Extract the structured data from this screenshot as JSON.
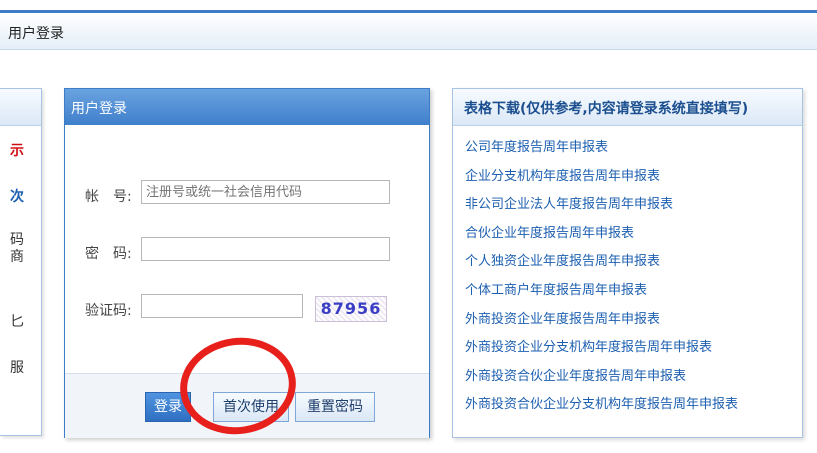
{
  "page": {
    "title": "用户登录"
  },
  "left_panel": {
    "fragments": [
      "示",
      "次",
      "码",
      "商",
      "匕",
      "服"
    ]
  },
  "login": {
    "header": "用户登录",
    "account_label": "帐　号:",
    "account_placeholder": "注册号或统一社会信用代码",
    "password_label": "密　码:",
    "captcha_label": "验证码:",
    "captcha_text": "87956",
    "buttons": {
      "login": "登录",
      "first_use": "首次使用",
      "reset": "重置密码"
    }
  },
  "downloads": {
    "header": "表格下载(仅供参考,内容请登录系统直接填写)",
    "items": [
      "公司年度报告周年申报表",
      "企业分支机构年度报告周年申报表",
      "非公司企业法人年度报告周年申报表",
      "合伙企业年度报告周年申报表",
      "个人独资企业年度报告周年申报表",
      "个体工商户年度报告周年申报表",
      "外商投资企业年度报告周年申报表",
      "外商投资企业分支机构年度报告周年申报表",
      "外商投资合伙企业年度报告周年申报表",
      "外商投资合伙企业分支机构年度报告周年申报表"
    ]
  },
  "colors": {
    "accent": "#3d7cc6",
    "highlight_circle": "#e8201c",
    "link": "#1c5fb0"
  }
}
